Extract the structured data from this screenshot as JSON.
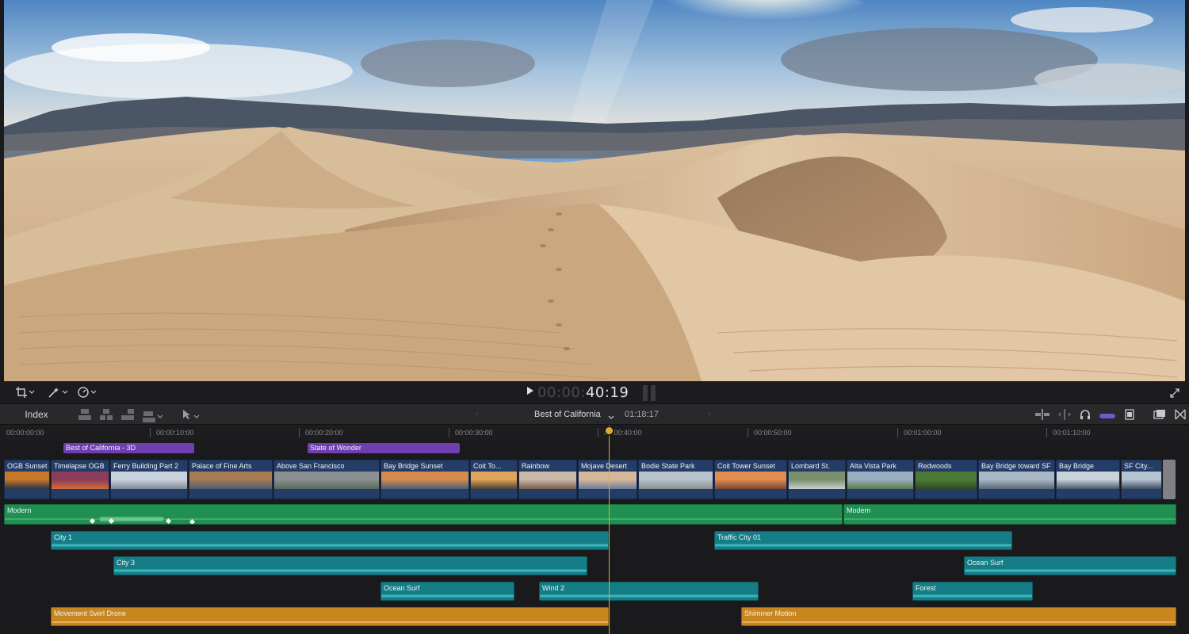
{
  "viewer": {
    "scene": "desert-dunes"
  },
  "transport": {
    "timecode_dim": "00:00:",
    "timecode_bright": "40:19",
    "icons": [
      "crop-icon",
      "magic-wand-icon",
      "speed-gauge-icon",
      "play-icon",
      "fullscreen-icon"
    ]
  },
  "timeline_bar": {
    "index_label": "Index",
    "project_name": "Best of California",
    "project_duration": "01:18:17",
    "icons": [
      "connect-clip-icon",
      "insert-clip-icon",
      "append-clip-icon",
      "overwrite-clip-icon",
      "select-tool-icon",
      "audio-skimming-icon",
      "snapping-icon",
      "solo-icon",
      "skimming-icon",
      "clip-appearance-icon",
      "browser-icon",
      "transitions-icon"
    ]
  },
  "ruler": {
    "ticks": [
      "00:00:00:00",
      "00:00:10:00",
      "00:00:20:00",
      "00:00:30:00",
      "00:00:40:00",
      "00:00:50:00",
      "00:01:00:00",
      "00:01:10:00"
    ]
  },
  "titles": [
    {
      "label": "Best of California - 3D"
    },
    {
      "label": "State of Wonder"
    }
  ],
  "video_clips": [
    {
      "label": "OGB Sunset",
      "colors": [
        "#c9782a",
        "#2b3445"
      ]
    },
    {
      "label": "Timelapse OGB",
      "colors": [
        "#8a3c5a",
        "#d46b3a"
      ]
    },
    {
      "label": "Ferry Building Part 2",
      "colors": [
        "#c8d2dc",
        "#7d8a96"
      ]
    },
    {
      "label": "Palace of Fine Arts",
      "colors": [
        "#a77a52",
        "#4f5e6e"
      ]
    },
    {
      "label": "Above San Francisco",
      "colors": [
        "#8c8f91",
        "#596a5c"
      ]
    },
    {
      "label": "Bay Bridge Sunset",
      "colors": [
        "#d68a4b",
        "#4a5f7a"
      ]
    },
    {
      "label": "Coit To...",
      "colors": [
        "#e0a35a",
        "#4a4236"
      ]
    },
    {
      "label": "Rainbow",
      "colors": [
        "#c9b8a8",
        "#7a5e4a"
      ]
    },
    {
      "label": "Mojave Desert",
      "colors": [
        "#d7b79a",
        "#6c7e96"
      ]
    },
    {
      "label": "Bodie State Park",
      "colors": [
        "#b7c2cc",
        "#8c8f91"
      ]
    },
    {
      "label": "Coit Tower Sunset",
      "colors": [
        "#e08d4f",
        "#7a4a36"
      ]
    },
    {
      "label": "Lombard St.",
      "colors": [
        "#7a8f6a",
        "#c9cdd0"
      ]
    },
    {
      "label": "Alta Vista Park",
      "colors": [
        "#9ab0c2",
        "#5d7a4a"
      ]
    },
    {
      "label": "Redwoods",
      "colors": [
        "#4a7a36",
        "#2e4a24"
      ]
    },
    {
      "label": "Bay Bridge toward SF",
      "colors": [
        "#aab8c6",
        "#5a6876"
      ]
    },
    {
      "label": "Bay Bridge",
      "colors": [
        "#c9d2da",
        "#4a5a6a"
      ]
    },
    {
      "label": "SF City...",
      "colors": [
        "#b6c4d2",
        "#3e4e60"
      ]
    }
  ],
  "audio_clips": {
    "music_1": {
      "label": "Modern"
    },
    "music_2": {
      "label": "Modern"
    },
    "city_1": {
      "label": "City 1"
    },
    "traffic": {
      "label": "Traffic City 01"
    },
    "city_3": {
      "label": "City 3"
    },
    "ocean_2": {
      "label": "Ocean Surf"
    },
    "ocean_1": {
      "label": "Ocean Surf"
    },
    "wind": {
      "label": "Wind 2"
    },
    "forest": {
      "label": "Forest"
    },
    "drone": {
      "label": "Movement Swirl Drone"
    },
    "shimmer": {
      "label": "Shimmer Motion"
    }
  },
  "colors": {
    "playhead": "#d9b02c",
    "title_clip": "#6f3fb0",
    "video_clip": "#243d66",
    "music_clip": "#1f8f52",
    "sfx_clip": "#147d86",
    "orange_clip": "#c9861f"
  }
}
